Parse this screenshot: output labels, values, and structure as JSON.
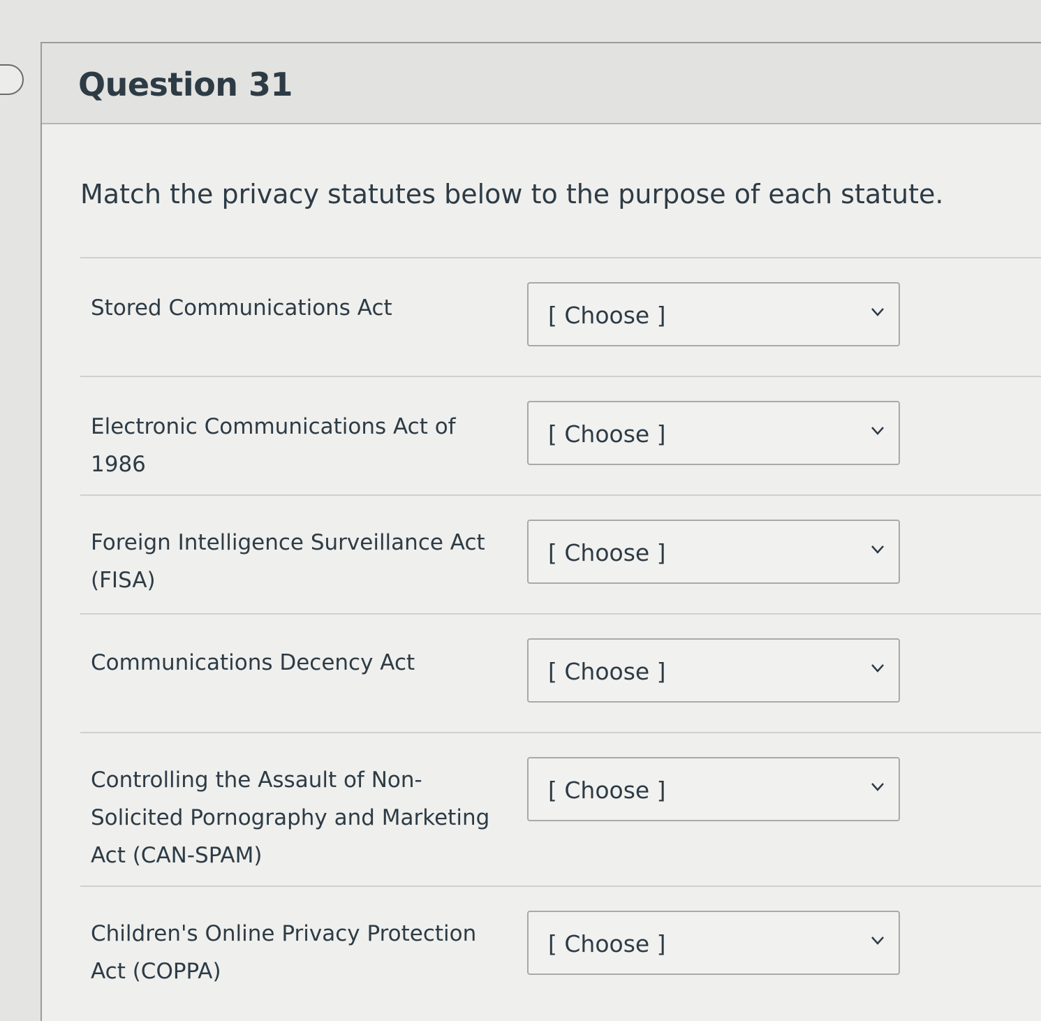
{
  "question": {
    "title": "Question 31",
    "prompt": "Match the privacy statutes below to the purpose of each statute."
  },
  "matches": [
    {
      "label": "Stored Communications Act",
      "selected": "[ Choose ]"
    },
    {
      "label": "Electronic Communications Act of 1986",
      "selected": "[ Choose ]"
    },
    {
      "label": "Foreign Intelligence Surveillance Act (FISA)",
      "selected": "[ Choose ]"
    },
    {
      "label": "Communications Decency Act",
      "selected": "[ Choose ]"
    },
    {
      "label": "Controlling the Assault of Non-Solicited Pornography and Marketing Act (CAN-SPAM)",
      "selected": "[ Choose ]"
    },
    {
      "label": "Children's Online Privacy Protection Act (COPPA)",
      "selected": "[ Choose ]"
    }
  ],
  "icons": {
    "select": "chevron-down-icon",
    "flag": "question-flag-icon"
  },
  "colors": {
    "text": "#2d3b45",
    "background": "#efefed",
    "header": "#e2e2e0",
    "border": "#a9a9a7"
  }
}
